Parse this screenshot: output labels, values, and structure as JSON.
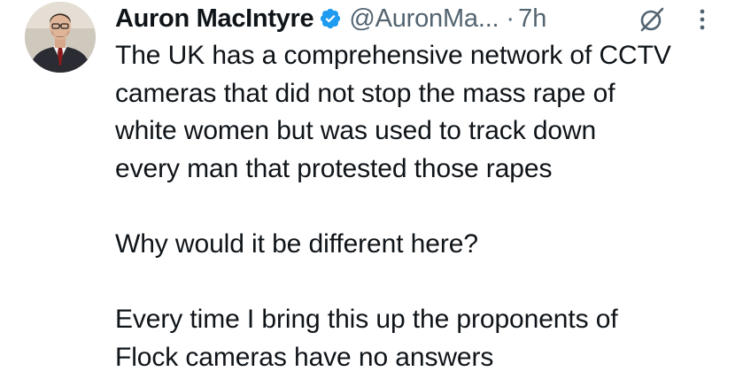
{
  "tweet": {
    "author": {
      "display_name": "Auron MacIntyre",
      "handle": "@AuronMa...",
      "verified": true,
      "avatar": "avatar-photo"
    },
    "separator": "·",
    "time": "7h",
    "icons": {
      "grok": "grok-icon",
      "more": "more-options-icon",
      "verified": "verified-badge-icon"
    },
    "colors": {
      "verified_blue": "#1d9bf0",
      "text": "#0f1419",
      "secondary": "#536471"
    },
    "body_lines": [
      "The UK has a comprehensive network of CCTV",
      "cameras that did not stop the mass rape of",
      "white women but was used to track down",
      "every man that protested those rapes",
      "",
      "Why would it be different here?",
      "",
      "Every time I bring this up the proponents of",
      "Flock cameras have no answers"
    ]
  }
}
